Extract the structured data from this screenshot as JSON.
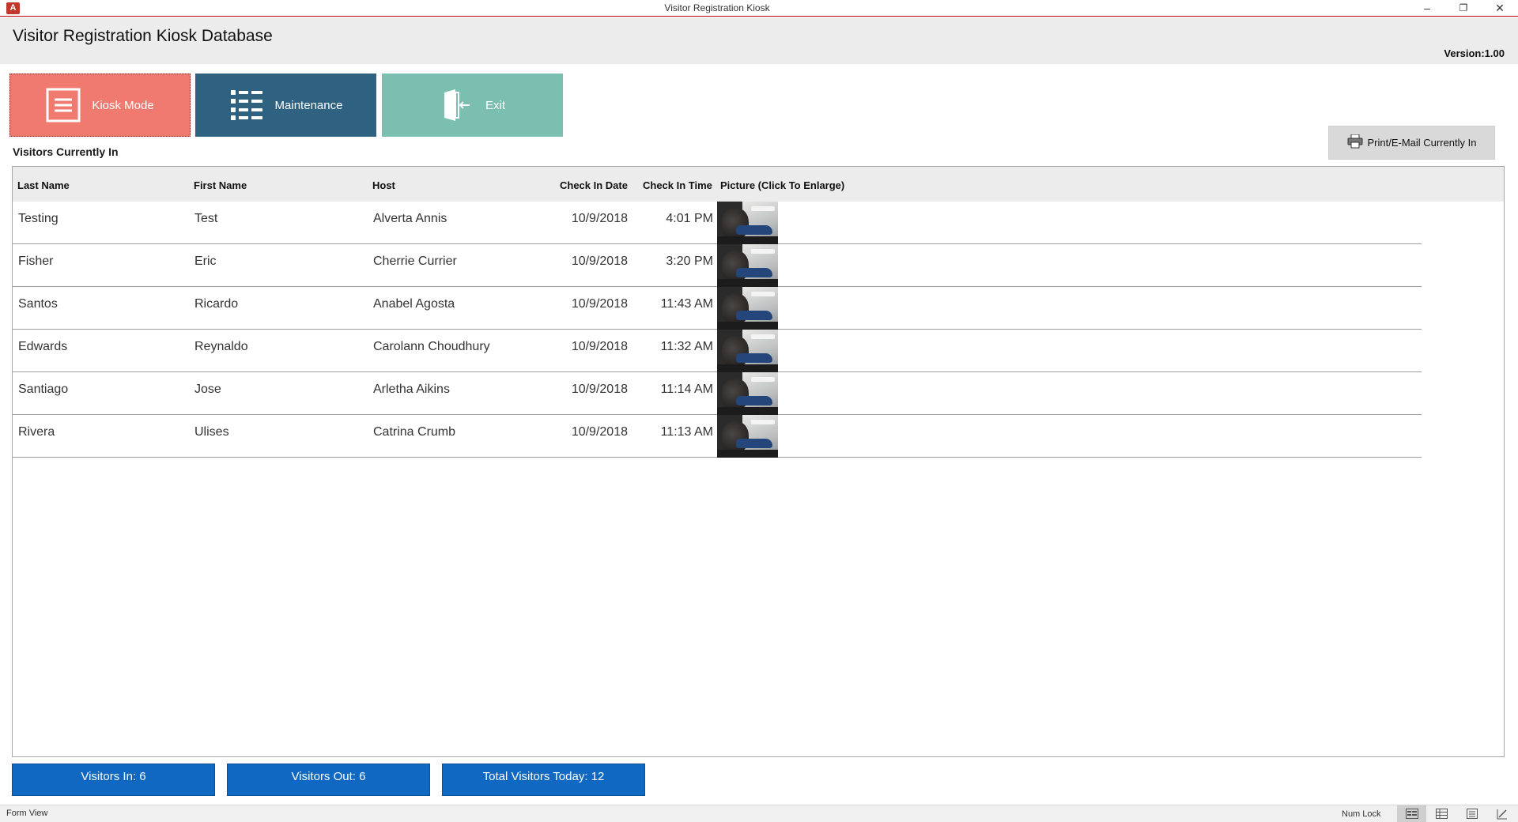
{
  "window": {
    "title": "Visitor Registration Kiosk",
    "app_icon": "access-icon",
    "controls": {
      "minimize": "–",
      "restore": "❐",
      "close": "✕"
    }
  },
  "header": {
    "title": "Visitor Registration Kiosk Database",
    "version": "Version:1.00"
  },
  "tiles": {
    "kiosk": {
      "label": "Kiosk Mode",
      "icon": "list-box-icon",
      "color": "#f07a70"
    },
    "maintenance": {
      "label": "Maintenance",
      "icon": "bulleted-list-icon",
      "color": "#2e6280"
    },
    "exit": {
      "label": "Exit",
      "icon": "door-exit-icon",
      "color": "#7bbfb1"
    }
  },
  "print_button": {
    "label": "Print/E-Mail Currently In",
    "icon": "printer-icon"
  },
  "section_label": "Visitors Currently In",
  "table": {
    "columns": [
      "Last Name",
      "First Name",
      "Host",
      "Check In Date",
      "Check In Time",
      "Picture (Click To Enlarge)"
    ],
    "rows": [
      {
        "last": "Testing",
        "first": "Test",
        "host": "Alverta Annis",
        "date": "10/9/2018",
        "time": "4:01 PM"
      },
      {
        "last": "Fisher",
        "first": "Eric",
        "host": "Cherrie Currier",
        "date": "10/9/2018",
        "time": "3:20 PM"
      },
      {
        "last": "Santos",
        "first": "Ricardo",
        "host": "Anabel Agosta",
        "date": "10/9/2018",
        "time": "11:43 AM"
      },
      {
        "last": "Edwards",
        "first": "Reynaldo",
        "host": "Carolann Choudhury",
        "date": "10/9/2018",
        "time": "11:32 AM"
      },
      {
        "last": "Santiago",
        "first": "Jose",
        "host": "Arletha Aikins",
        "date": "10/9/2018",
        "time": "11:14 AM"
      },
      {
        "last": "Rivera",
        "first": "Ulises",
        "host": "Catrina Crumb",
        "date": "10/9/2018",
        "time": "11:13 AM"
      }
    ]
  },
  "counters": {
    "in": "Visitors In: 6",
    "out": "Visitors Out: 6",
    "total": "Total Visitors Today: 12",
    "color": "#1168c2"
  },
  "statusbar": {
    "left": "Form View",
    "numlock": "Num Lock",
    "views": [
      "form-view-icon",
      "datasheet-view-icon",
      "layout-view-icon",
      "design-view-icon"
    ]
  }
}
